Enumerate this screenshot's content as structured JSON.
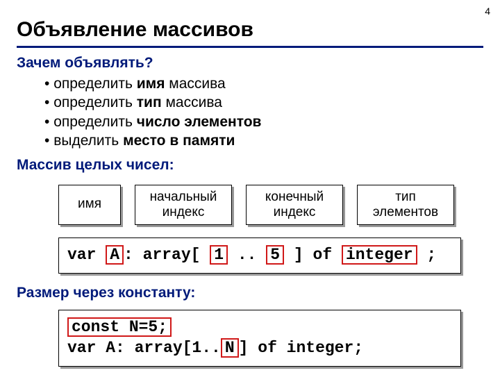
{
  "page_number": "4",
  "title": "Объявление массивов",
  "section1": {
    "heading": "Зачем объявлять?",
    "items": [
      {
        "pre": "определить ",
        "bold": "имя",
        "post": " массива"
      },
      {
        "pre": "определить ",
        "bold": "тип",
        "post": " массива"
      },
      {
        "pre": "определить ",
        "bold": "число элементов",
        "post": ""
      },
      {
        "pre": "выделить ",
        "bold": "место в памяти",
        "post": ""
      }
    ]
  },
  "section2": {
    "heading": "Массив целых чисел:",
    "labels": {
      "l1": "имя",
      "l2a": "начальный",
      "l2b": "индекс",
      "l3a": "конечный",
      "l3b": "индекс",
      "l4a": "тип",
      "l4b": "элементов"
    },
    "code": {
      "t1": "var ",
      "h1": "A",
      "t2": ": array[ ",
      "h2": "1",
      "t3": " .. ",
      "h3": "5",
      "t4": " ] of ",
      "h4": "integer",
      "t5": " ;"
    }
  },
  "section3": {
    "heading": "Размер через константу:",
    "code": {
      "line1": "const N=5;",
      "t1": "var A: array[1..",
      "h1": "N",
      "t2": "] of integer;"
    }
  }
}
